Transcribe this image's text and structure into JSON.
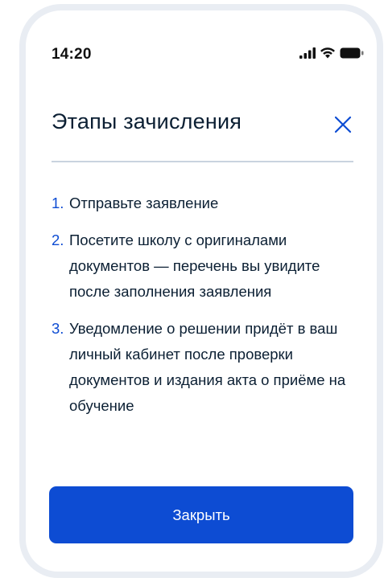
{
  "status_bar": {
    "time": "14:20",
    "icons": [
      "signal-icon",
      "wifi-icon",
      "battery-icon"
    ]
  },
  "modal": {
    "title": "Этапы зачисления",
    "steps": [
      {
        "number": "1.",
        "text": "Отправьте заявление"
      },
      {
        "number": "2.",
        "text": "Посетите школу с оригиналами документов — перечень вы увидите после заполнения заявления"
      },
      {
        "number": "3.",
        "text": "Уведомление о решении придёт в ваш личный кабинет после проверки документов и издания акта о приёме на обучение"
      }
    ],
    "close_button_label": "Закрыть"
  },
  "colors": {
    "accent": "#0d4cd3",
    "text": "#0b1f33",
    "divider": "#c9d3df",
    "frame": "#e9edf3"
  }
}
